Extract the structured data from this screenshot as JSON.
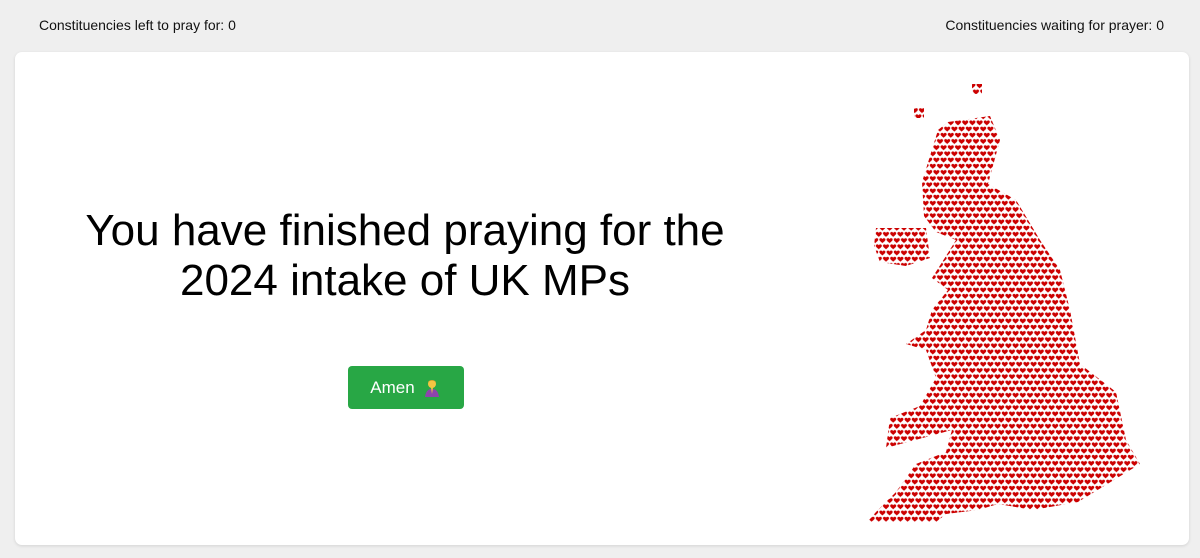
{
  "header": {
    "left_counter": "Constituencies left to pray for: 0",
    "right_counter": "Constituencies waiting for prayer: 0"
  },
  "main": {
    "message_line1": "You have finished praying for the",
    "message_line2": "2024 intake of UK MPs",
    "button": {
      "label": "Amen",
      "icon": "praying-person-icon"
    }
  },
  "map": {
    "icon": "heart-icon",
    "heart_color": "#cc0000",
    "region": "UK constituencies"
  },
  "colors": {
    "page_background": "#efefef",
    "card_background": "#ffffff",
    "button_green": "#28a745",
    "heart_red": "#cc0000"
  }
}
